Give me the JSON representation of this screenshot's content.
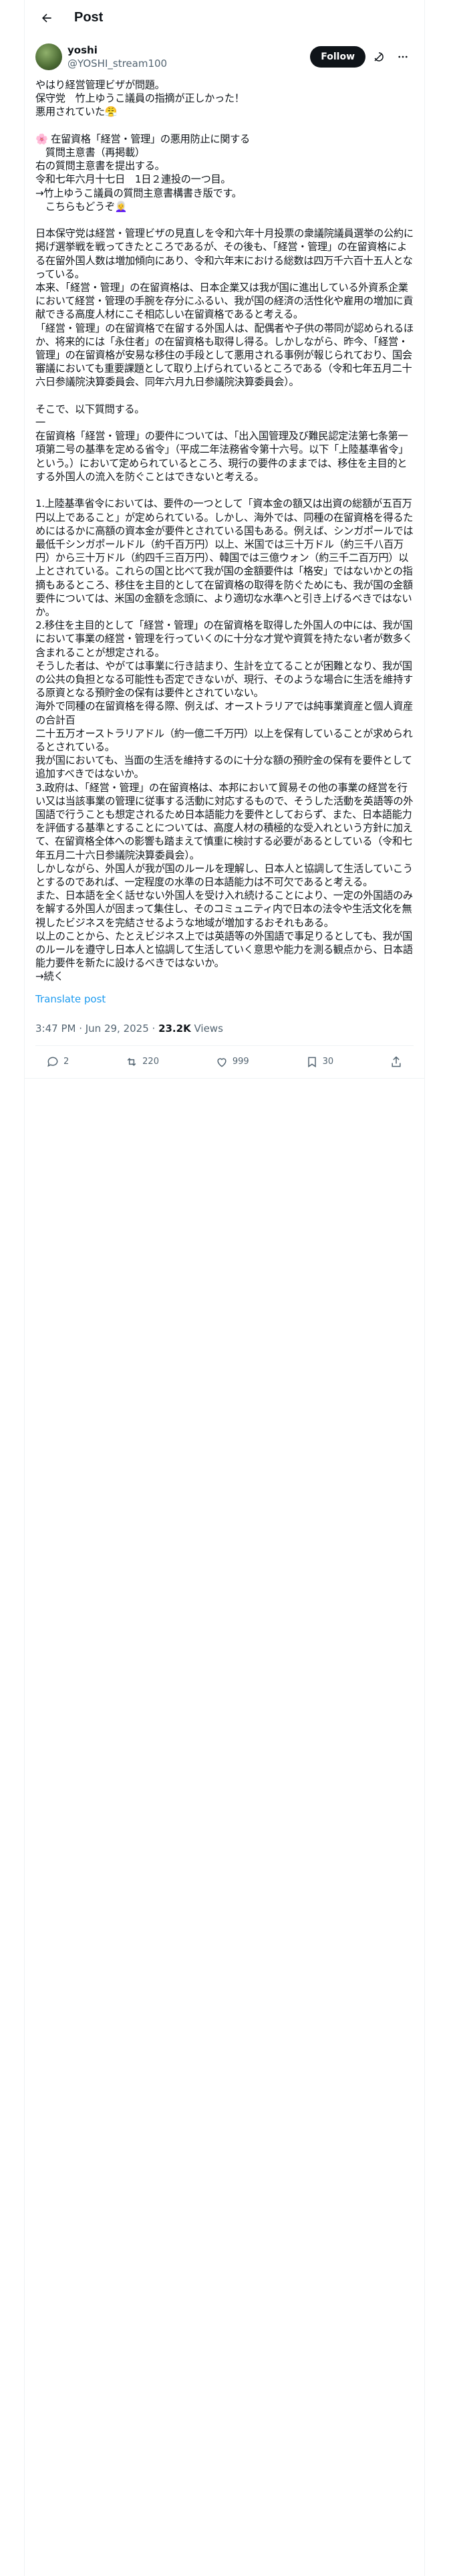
{
  "header": {
    "title": "Post"
  },
  "author": {
    "name": "yoshi",
    "handle": "@YOSHI_stream100",
    "follow_label": "Follow"
  },
  "tweet": {
    "text": "やはり経営管理ビザが問題。\n保守党　竹上ゆうこ議員の指摘が正しかった！\n悪用されていた😤\n\n🌸 在留資格「経営・管理」の悪用防止に関する\n　質問主意書（再掲載）\n右の質問主意書を提出する。\n令和七年六月十七日　1日２連投の一つ目。\n→竹上ゆうこ議員の質問主意書構書き版です。\n　こちらもどうぞ👩‍🦳\n\n日本保守党は経営・管理ビザの見直しを令和六年十月投票の衆議院議員選挙の公約に掲げ選挙戦を戦ってきたところであるが、その後も、「経営・管理」の在留資格による在留外国人数は増加傾向にあり、令和六年末における総数は四万千六百十五人となっている。\n本来、「経営・管理」の在留資格は、日本企業又は我が国に進出している外資系企業において経営・管理の手腕を存分にふるい、我が国の経済の活性化や雇用の増加に貢献できる高度人材にこそ相応しい在留資格であると考える。\n「経営・管理」の在留資格で在留する外国人は、配偶者や子供の帯同が認められるほか、将来的には「永住者」の在留資格も取得し得る。しかしながら、昨今、「経営・管理」の在留資格が安易な移住の手段として悪用される事例が報じられており、国会審議においても重要課題として取り上げられているところである（令和七年五月二十六日参議院決算委員会、同年六月九日参議院決算委員会）。\n\nそこで、以下質問する。\n一\n在留資格「経営・管理」の要件については、「出入国管理及び難民認定法第七条第一項第二号の基準を定める省令」（平成二年法務省令第十六号。以下「上陸基準省令」という。）において定められているところ、現行の要件のままでは、移住を主目的とする外国人の流入を防ぐことはできないと考える。\n\n1.上陸基準省令においては、要件の一つとして「資本金の額又は出資の総額が五百万円以上であること」が定められている。しかし、海外では、同種の在留資格を得るためにはるかに高額の資本金が要件とされている国もある。例えば、シンガポールでは最低千シンガポールドル（約千百万円）以上、米国では三十万ドル（約三千八百万円）から三十万ドル（約四千三百万円）、韓国では三億ウォン（約三千二百万円）以上とされている。これらの国と比べて我が国の金額要件は「格安」ではないかとの指摘もあるところ、移住を主目的として在留資格の取得を防ぐためにも、我が国の金額要件については、米国の金額を念頭に、より適切な水準へと引き上げるべきではないか。\n2.移住を主目的として「経営・管理」の在留資格を取得した外国人の中には、我が国において事業の経営・管理を行っていくのに十分な才覚や資質を持たない者が数多く含まれることが想定される。\nそうした者は、やがては事業に行き詰まり、生計を立てることが困難となり、我が国の公共の負担となる可能性も否定できないが、現行、そのような場合に生活を維持する原資となる預貯金の保有は要件とされていない。\n海外で同種の在留資格を得る際、例えば、オーストラリアでは純事業資産と個人資産の合計百\n二十五万オーストラリアドル（約一億二千万円）以上を保有していることが求められるとされている。\n我が国においても、当面の生活を維持するのに十分な額の預貯金の保有を要件として追加すべきではないか。\n3.政府は、「経営・管理」の在留資格は、本邦において貿易その他の事業の経営を行い又は当該事業の管理に従事する活動に対応するもので、そうした活動を英語等の外国語で行うことも想定されるため日本語能力を要件としておらず、また、日本語能力を評価する基準とすることについては、高度人材の積極的な受入れという方針に加えて、在留資格全体への影響も踏まえて慎重に検討する必要があるとしている（令和七年五月二十六日参議院決算委員会）。\nしかしながら、外国人が我が国のルールを理解し、日本人と協調して生活していこうとするのであれば、一定程度の水準の日本語能力は不可欠であると考える。\nまた、日本語を全く話せない外国人を受け入れ続けることにより、一定の外国語のみを解する外国人が固まって集住し、そのコミュニティ内で日本の法令や生活文化を無視したビジネスを完結させるような地域が増加するおそれもある。\n以上のことから、たとえビジネス上では英語等の外国語で事足りるとしても、我が国のルールを遵守し日本人と協調して生活していく意思や能力を測る観点から、日本語能力要件を新たに設けるべきではないか。\n→続く"
  },
  "translate_label": "Translate post",
  "meta": {
    "time": "3:47 PM · Jun 29, 2025 · ",
    "views_count": "23.2K",
    "views_label": " Views"
  },
  "actions": {
    "replies": "2",
    "reposts": "220",
    "likes": "999",
    "bookmarks": "30"
  }
}
